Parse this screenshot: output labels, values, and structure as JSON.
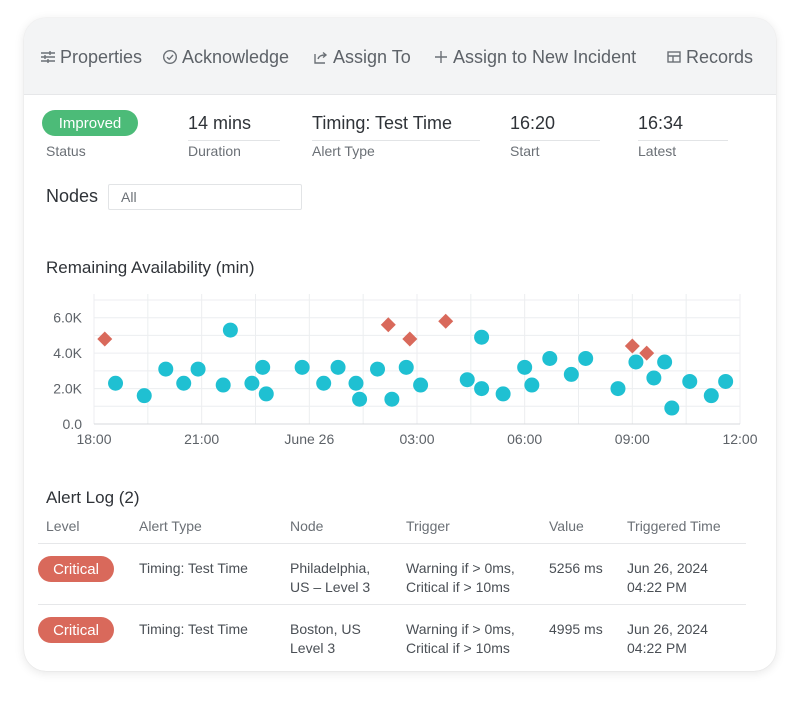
{
  "toolbar": {
    "properties": "Properties",
    "acknowledge": "Acknowledge",
    "assign_to": "Assign To",
    "assign_new_incident": "Assign to New Incident",
    "records": "Records"
  },
  "summary": {
    "status": {
      "value": "Improved",
      "label": "Status",
      "color": "#4cbb78"
    },
    "duration": {
      "value": "14 mins",
      "label": "Duration"
    },
    "alert_type": {
      "value": "Timing: Test Time",
      "label": "Alert Type"
    },
    "start": {
      "value": "16:20",
      "label": "Start"
    },
    "latest": {
      "value": "16:34",
      "label": "Latest"
    }
  },
  "nodes": {
    "label": "Nodes",
    "selected": "All"
  },
  "chart_data": {
    "type": "scatter",
    "title": "Remaining Availability (min)",
    "xlabel": "",
    "ylabel": "",
    "x_tick_labels": [
      "18:00",
      "21:00",
      "June 26",
      "03:00",
      "06:00",
      "09:00",
      "12:00"
    ],
    "x_tick_hours": [
      0,
      3,
      6,
      9,
      12,
      15,
      18
    ],
    "y_tick_labels": [
      "0.0",
      "2.0K",
      "4.0K",
      "6.0K"
    ],
    "y_tick_values": [
      0,
      2000,
      4000,
      6000
    ],
    "ylim": [
      0,
      7000
    ],
    "xlim_hours": [
      0,
      18
    ],
    "grid": true,
    "colors": {
      "normal": "#1fc0d2",
      "critical": "#d9695b"
    },
    "series": [
      {
        "marker": "circle",
        "points": [
          [
            0.6,
            2300
          ],
          [
            1.4,
            1600
          ],
          [
            2.0,
            3100
          ],
          [
            2.5,
            2300
          ],
          [
            2.9,
            3100
          ],
          [
            3.6,
            2200
          ],
          [
            3.8,
            5300
          ],
          [
            4.4,
            2300
          ],
          [
            4.7,
            3200
          ],
          [
            4.8,
            1700
          ],
          [
            5.8,
            3200
          ],
          [
            6.4,
            2300
          ],
          [
            6.8,
            3200
          ],
          [
            7.3,
            2300
          ],
          [
            7.4,
            1400
          ],
          [
            7.9,
            3100
          ],
          [
            8.3,
            1400
          ],
          [
            8.7,
            3200
          ],
          [
            9.1,
            2200
          ],
          [
            10.4,
            2500
          ],
          [
            10.8,
            4900
          ],
          [
            10.8,
            2000
          ],
          [
            11.4,
            1700
          ],
          [
            12.0,
            3200
          ],
          [
            12.2,
            2200
          ],
          [
            12.7,
            3700
          ],
          [
            13.3,
            2800
          ],
          [
            13.7,
            3700
          ],
          [
            14.6,
            2000
          ],
          [
            15.1,
            3500
          ],
          [
            15.6,
            2600
          ],
          [
            15.9,
            3500
          ],
          [
            16.1,
            900
          ],
          [
            16.6,
            2400
          ],
          [
            17.2,
            1600
          ],
          [
            17.6,
            2400
          ]
        ]
      },
      {
        "marker": "diamond",
        "points": [
          [
            0.3,
            4800
          ],
          [
            8.2,
            5600
          ],
          [
            8.8,
            4800
          ],
          [
            9.8,
            5800
          ],
          [
            15.0,
            4400
          ],
          [
            15.4,
            4000
          ]
        ]
      }
    ]
  },
  "alert_log": {
    "title": "Alert Log (2)",
    "columns": [
      "Level",
      "Alert Type",
      "Node",
      "Trigger",
      "Value",
      "Triggered Time"
    ],
    "rows": [
      {
        "level": "Critical",
        "alert_type": "Timing: Test Time",
        "node_line1": "Philadelphia,",
        "node_line2": "US – Level 3",
        "trigger_line1": "Warning if > 0ms,",
        "trigger_line2": "Critical if > 10ms",
        "value": "5256 ms",
        "time_line1": "Jun 26, 2024",
        "time_line2": "04:22 PM"
      },
      {
        "level": "Critical",
        "alert_type": "Timing: Test Time",
        "node_line1": "Boston, US",
        "node_line2": "Level 3",
        "trigger_line1": "Warning if > 0ms,",
        "trigger_line2": "Critical if > 10ms",
        "value": "4995 ms",
        "time_line1": "Jun 26, 2024",
        "time_line2": "04:22 PM"
      }
    ],
    "level_color": "#d9695b"
  }
}
